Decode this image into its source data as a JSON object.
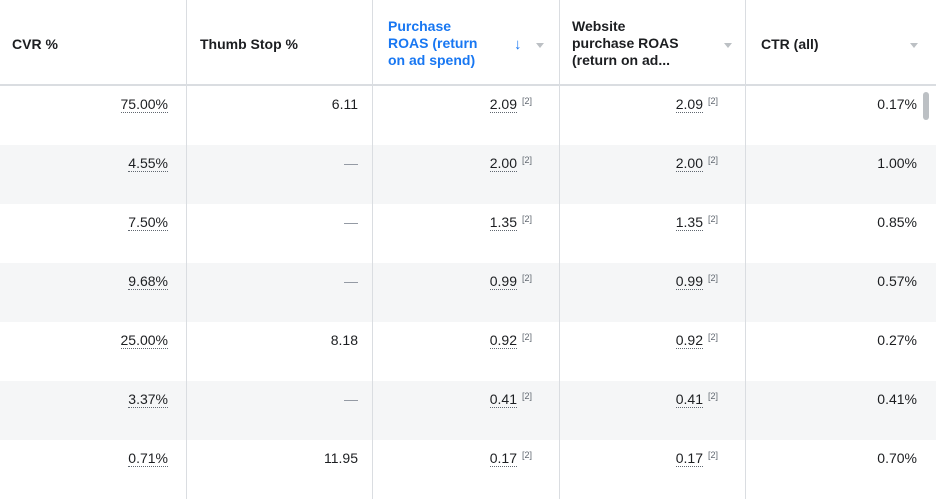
{
  "columns": [
    {
      "label_lines": [
        "CVR %"
      ]
    },
    {
      "label_lines": [
        "Thumb Stop %"
      ]
    },
    {
      "label_lines": [
        "Purchase",
        "ROAS (return",
        "on ad spend)"
      ]
    },
    {
      "label_lines": [
        "Website",
        "purchase ROAS",
        "(return on ad..."
      ]
    },
    {
      "label_lines": [
        "CTR (all)"
      ]
    }
  ],
  "sort_icon": "arrow-down-icon",
  "footnote_marker": "[2]",
  "rows": [
    {
      "cvr": "75.00%",
      "thumb_stop": "6.11",
      "purchase_roas": "2.09",
      "website_roas": "2.09",
      "ctr": "0.17%"
    },
    {
      "cvr": "4.55%",
      "thumb_stop": "—",
      "purchase_roas": "2.00",
      "website_roas": "2.00",
      "ctr": "1.00%"
    },
    {
      "cvr": "7.50%",
      "thumb_stop": "—",
      "purchase_roas": "1.35",
      "website_roas": "1.35",
      "ctr": "0.85%"
    },
    {
      "cvr": "9.68%",
      "thumb_stop": "—",
      "purchase_roas": "0.99",
      "website_roas": "0.99",
      "ctr": "0.57%"
    },
    {
      "cvr": "25.00%",
      "thumb_stop": "8.18",
      "purchase_roas": "0.92",
      "website_roas": "0.92",
      "ctr": "0.27%"
    },
    {
      "cvr": "3.37%",
      "thumb_stop": "—",
      "purchase_roas": "0.41",
      "website_roas": "0.41",
      "ctr": "0.41%"
    },
    {
      "cvr": "0.71%",
      "thumb_stop": "11.95",
      "purchase_roas": "0.17",
      "website_roas": "0.17",
      "ctr": "0.70%"
    }
  ],
  "colors": {
    "accent": "#1877f2",
    "row_alt": "#f5f6f7",
    "border": "#dadde1"
  }
}
